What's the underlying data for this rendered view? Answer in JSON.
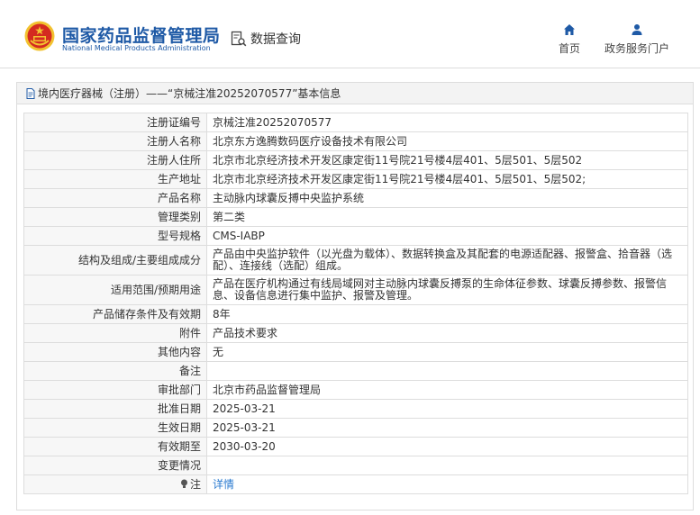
{
  "header": {
    "brand_cn": "国家药品监督管理局",
    "brand_en": "National Medical Products Administration",
    "data_query": "数据查询",
    "nav": {
      "home": "首页",
      "portal": "政务服务门户"
    }
  },
  "panel": {
    "title": "境内医疗器械（注册）——“京械注准20252070577”基本信息",
    "rows": [
      {
        "label": "注册证编号",
        "value": "京械注准20252070577"
      },
      {
        "label": "注册人名称",
        "value": "北京东方逸腾数码医疗设备技术有限公司"
      },
      {
        "label": "注册人住所",
        "value": "北京市北京经济技术开发区康定街11号院21号楼4层401、5层501、5层502"
      },
      {
        "label": "生产地址",
        "value": "北京市北京经济技术开发区康定街11号院21号楼4层401、5层501、5层502;"
      },
      {
        "label": "产品名称",
        "value": "主动脉内球囊反搏中央监护系统"
      },
      {
        "label": "管理类别",
        "value": "第二类"
      },
      {
        "label": "型号规格",
        "value": "CMS-IABP"
      },
      {
        "label": "结构及组成/主要组成成分",
        "value": "产品由中央监护软件（以光盘为载体）、数据转换盒及其配套的电源适配器、报警盒、拾音器（选配）、连接线（选配）组成。"
      },
      {
        "label": "适用范围/预期用途",
        "value": "产品在医疗机构通过有线局域网对主动脉内球囊反搏泵的生命体征参数、球囊反搏参数、报警信息、设备信息进行集中监护、报警及管理。"
      },
      {
        "label": "产品储存条件及有效期",
        "value": "8年"
      },
      {
        "label": "附件",
        "value": "产品技术要求"
      },
      {
        "label": "其他内容",
        "value": "无"
      },
      {
        "label": "备注",
        "value": ""
      },
      {
        "label": "审批部门",
        "value": "北京市药品监督管理局"
      },
      {
        "label": "批准日期",
        "value": "2025-03-21"
      },
      {
        "label": "生效日期",
        "value": "2025-03-21"
      },
      {
        "label": "有效期至",
        "value": "2030-03-20"
      },
      {
        "label": "变更情况",
        "value": ""
      }
    ],
    "note_label": "注",
    "note_link": "详情"
  },
  "colors": {
    "brand_blue": "#1f5aa6",
    "link_blue": "#2b7bd0",
    "emblem_red": "#d42a20",
    "emblem_gold": "#f2c230"
  }
}
